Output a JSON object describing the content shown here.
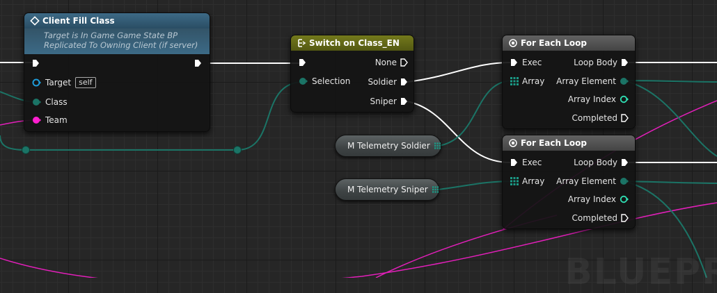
{
  "canvas": {
    "watermark": "BLUEPR"
  },
  "nodes": {
    "client_fill_class": {
      "title": "Client Fill Class",
      "subtitle_line1": "Target is In Game Game State BP",
      "subtitle_line2": "Replicated To Owning Client (if server)",
      "pins": {
        "target": "Target",
        "target_default": "self",
        "class": "Class",
        "team": "Team"
      }
    },
    "switch": {
      "title": "Switch on Class_EN",
      "pins": {
        "selection": "Selection",
        "none": "None",
        "soldier": "Soldier",
        "sniper": "Sniper"
      }
    },
    "for_each_1": {
      "title": "For Each Loop",
      "pins": {
        "exec": "Exec",
        "array": "Array",
        "loop_body": "Loop Body",
        "array_element": "Array Element",
        "array_index": "Array Index",
        "completed": "Completed"
      }
    },
    "for_each_2": {
      "title": "For Each Loop",
      "pins": {
        "exec": "Exec",
        "array": "Array",
        "loop_body": "Loop Body",
        "array_element": "Array Element",
        "array_index": "Array Index",
        "completed": "Completed"
      }
    },
    "var_soldier": {
      "label": "M Telemetry Soldier"
    },
    "var_sniper": {
      "label": "M Telemetry Sniper"
    }
  },
  "colors": {
    "exec_wire": "#ffffff",
    "object_pin": "#1b7466",
    "team_pin": "#ff1fcf",
    "target_pin": "#1e9bd8",
    "int_pin": "#2fe0b4"
  }
}
